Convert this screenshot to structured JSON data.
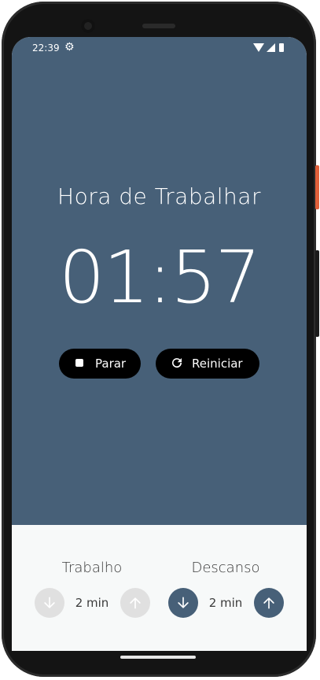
{
  "status_bar": {
    "time": "22:39",
    "icons": [
      "gear-icon",
      "wifi-icon",
      "signal-icon",
      "battery-icon"
    ]
  },
  "timer": {
    "title": "Hora de Trabalhar",
    "time": "01:57"
  },
  "controls": {
    "stop_label": "Parar",
    "restart_label": "Reiniciar"
  },
  "settings": {
    "work": {
      "label": "Trabalho",
      "value": "2 min"
    },
    "rest": {
      "label": "Descanso",
      "value": "2 min"
    }
  },
  "colors": {
    "primary": "#476078",
    "button_dark": "#000000",
    "disabled": "#e0e0e0",
    "bottom_bg": "#f7f9f9"
  }
}
